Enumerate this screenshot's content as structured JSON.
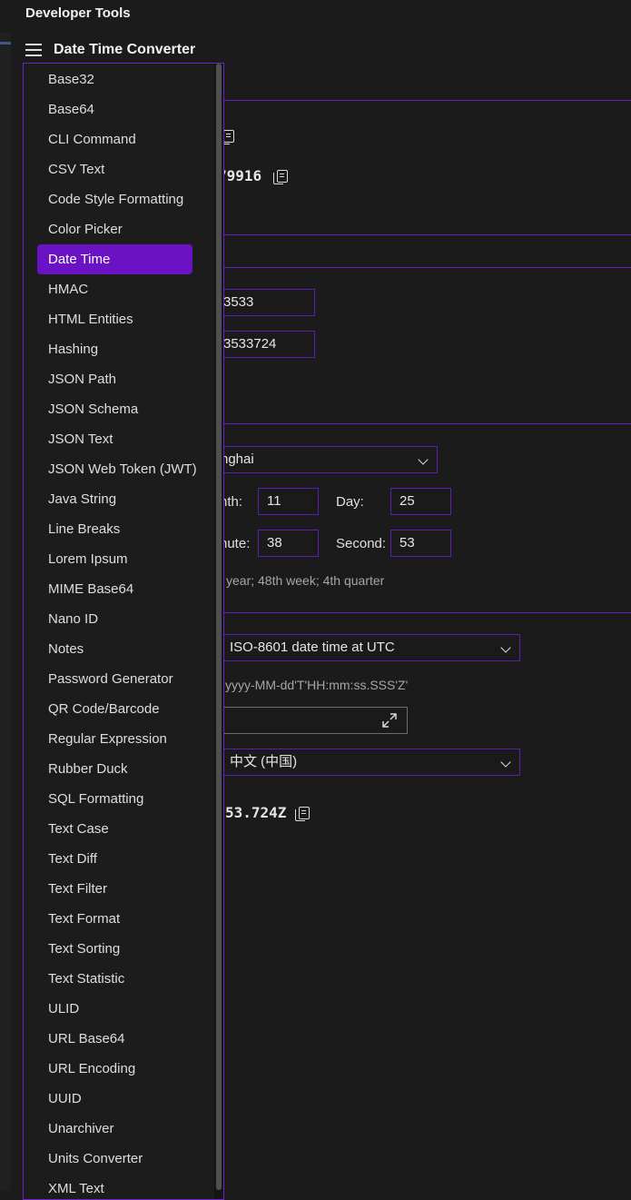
{
  "app": {
    "title": "Developer Tools"
  },
  "header": {
    "title": "Date Time Converter"
  },
  "sidebar": {
    "selected_index": 6,
    "items": [
      "Base32",
      "Base64",
      "CLI Command",
      "CSV Text",
      "Code Style Formatting",
      "Color Picker",
      "Date Time",
      "HMAC",
      "HTML Entities",
      "Hashing",
      "JSON Path",
      "JSON Schema",
      "JSON Text",
      "JSON Web Token (JWT)",
      "Java String",
      "Line Breaks",
      "Lorem Ipsum",
      "MIME Base64",
      "Nano ID",
      "Notes",
      "Password Generator",
      "QR Code/Barcode",
      "Regular Expression",
      "Rubber Duck",
      "SQL Formatting",
      "Text Case",
      "Text Diff",
      "Text Filter",
      "Text Format",
      "Text Sorting",
      "Text Statistic",
      "ULID",
      "URL Base64",
      "URL Encoding",
      "UUID",
      "Unarchiver",
      "Units Converter",
      "XML Text"
    ]
  },
  "content": {
    "current_value_partial": "79916",
    "epoch_seconds_partial": "3533",
    "epoch_millis_partial": "3533724",
    "timezone_partial": "nghai",
    "month_label_partial": "nth:",
    "month_value": "11",
    "day_label": "Day:",
    "day_value": "25",
    "minute_label_partial": "nute:",
    "minute_value": "38",
    "second_label": "Second:",
    "second_value": "53",
    "week_info_partial": "year; 48th week; 4th quarter",
    "format_select": "ISO-8601 date time at UTC",
    "format_pattern": "yyyy-MM-dd'T'HH:mm:ss.SSS'Z'",
    "locale_select": "中文 (中国)",
    "formatted_result_partial": "53.724Z"
  },
  "colors": {
    "accent": "#6b12c4",
    "border_accent": "#6c22cc",
    "background": "#1b1b1b"
  }
}
